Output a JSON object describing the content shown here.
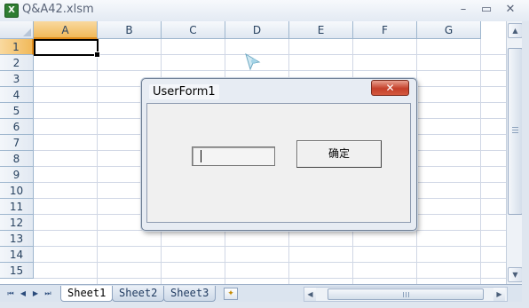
{
  "window": {
    "title": "Q&A42.xlsm",
    "minimize_glyph": "–",
    "restore_glyph": "▭",
    "close_glyph": "✕"
  },
  "grid": {
    "columns": [
      "A",
      "B",
      "C",
      "D",
      "E",
      "F",
      "G"
    ],
    "rows": [
      "1",
      "2",
      "3",
      "4",
      "5",
      "6",
      "7",
      "8",
      "9",
      "10",
      "11",
      "12",
      "13",
      "14",
      "15"
    ],
    "active_cell": "A1"
  },
  "sheets": {
    "tabs": [
      "Sheet1",
      "Sheet2",
      "Sheet3"
    ],
    "active": "Sheet1",
    "nav": [
      "⏮",
      "◀",
      "▶",
      "⏭"
    ],
    "new_sheet_glyph": "✦"
  },
  "userform": {
    "title": "UserForm1",
    "close_glyph": "✕",
    "textbox_value": "",
    "button_label": "确定"
  },
  "scroll": {
    "up": "▲",
    "down": "▼",
    "left": "◀",
    "right": "▶"
  },
  "colors": {
    "active_header": "#f1b95a",
    "close_red": "#c4402a",
    "gridline": "#d0d7e5"
  }
}
